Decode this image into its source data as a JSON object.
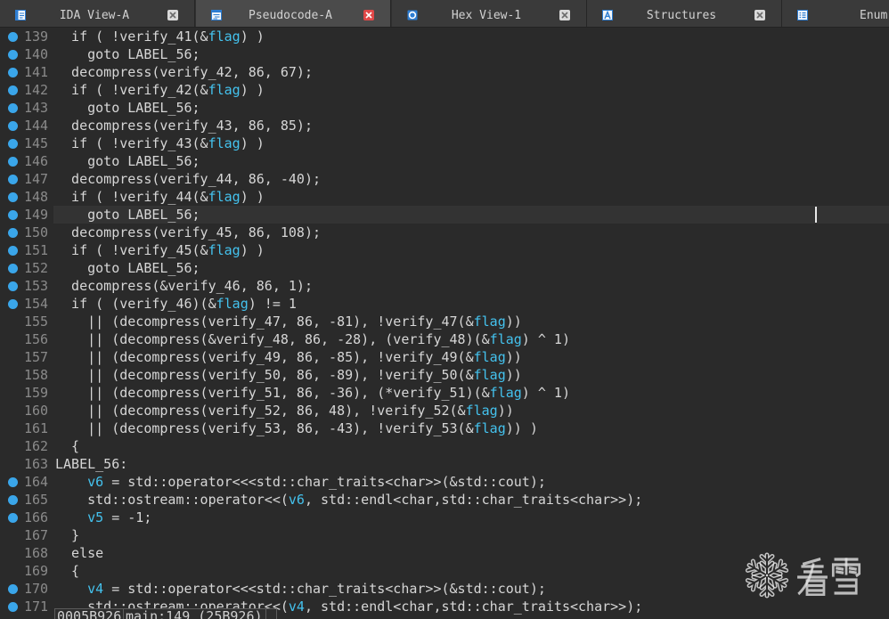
{
  "tabs": [
    {
      "label": "IDA View-A",
      "icon": "ida-view-icon",
      "active": false
    },
    {
      "label": "Pseudocode-A",
      "icon": "pseudocode-icon",
      "active": true
    },
    {
      "label": "Hex View-1",
      "icon": "hex-view-icon",
      "active": false
    },
    {
      "label": "Structures",
      "icon": "structures-icon",
      "active": false
    },
    {
      "label": "Enum",
      "icon": "enums-icon",
      "active": false
    }
  ],
  "colors": {
    "background": "#2a2a2a",
    "tab": "#3a3a3a",
    "active_tab": "#4b4b4b",
    "tab_text": "#d2d2d2",
    "close_active": "#e04848",
    "code_text": "#d6d6d6",
    "variable": "#44c2ee",
    "line_number": "#8a8a8a",
    "address_dot": "#3aa6ea",
    "current_line": "#333333"
  },
  "code": {
    "lines": [
      {
        "n": "139",
        "dot": true,
        "seg": [
          {
            "t": "  if ( !verify_41(&"
          },
          {
            "t": "flag",
            "c": "var"
          },
          {
            "t": ") )"
          }
        ]
      },
      {
        "n": "140",
        "dot": true,
        "seg": [
          {
            "t": "    goto LABEL_56;"
          }
        ]
      },
      {
        "n": "141",
        "dot": true,
        "seg": [
          {
            "t": "  decompress(verify_42, 86, 67);"
          }
        ]
      },
      {
        "n": "142",
        "dot": true,
        "seg": [
          {
            "t": "  if ( !verify_42(&"
          },
          {
            "t": "flag",
            "c": "var"
          },
          {
            "t": ") )"
          }
        ]
      },
      {
        "n": "143",
        "dot": true,
        "seg": [
          {
            "t": "    goto LABEL_56;"
          }
        ]
      },
      {
        "n": "144",
        "dot": true,
        "seg": [
          {
            "t": "  decompress(verify_43, 86, 85);"
          }
        ]
      },
      {
        "n": "145",
        "dot": true,
        "seg": [
          {
            "t": "  if ( !verify_43(&"
          },
          {
            "t": "flag",
            "c": "var"
          },
          {
            "t": ") )"
          }
        ]
      },
      {
        "n": "146",
        "dot": true,
        "seg": [
          {
            "t": "    goto LABEL_56;"
          }
        ]
      },
      {
        "n": "147",
        "dot": true,
        "seg": [
          {
            "t": "  decompress(verify_44, 86, -40);"
          }
        ]
      },
      {
        "n": "148",
        "dot": true,
        "seg": [
          {
            "t": "  if ( !verify_44(&"
          },
          {
            "t": "flag",
            "c": "var"
          },
          {
            "t": ") )"
          }
        ]
      },
      {
        "n": "149",
        "dot": true,
        "current": true,
        "seg": [
          {
            "t": "    goto LABEL_56;"
          }
        ]
      },
      {
        "n": "150",
        "dot": true,
        "seg": [
          {
            "t": "  decompress(verify_45, 86, 108);"
          }
        ]
      },
      {
        "n": "151",
        "dot": true,
        "seg": [
          {
            "t": "  if ( !verify_45(&"
          },
          {
            "t": "flag",
            "c": "var"
          },
          {
            "t": ") )"
          }
        ]
      },
      {
        "n": "152",
        "dot": true,
        "seg": [
          {
            "t": "    goto LABEL_56;"
          }
        ]
      },
      {
        "n": "153",
        "dot": true,
        "seg": [
          {
            "t": "  decompress(&verify_46, 86, 1);"
          }
        ]
      },
      {
        "n": "154",
        "dot": true,
        "seg": [
          {
            "t": "  if ( (verify_46)(&"
          },
          {
            "t": "flag",
            "c": "var"
          },
          {
            "t": ") != 1"
          }
        ]
      },
      {
        "n": "155",
        "dot": false,
        "seg": [
          {
            "t": "    || (decompress(verify_47, 86, -81), !verify_47(&"
          },
          {
            "t": "flag",
            "c": "var"
          },
          {
            "t": "))"
          }
        ]
      },
      {
        "n": "156",
        "dot": false,
        "seg": [
          {
            "t": "    || (decompress(&verify_48, 86, -28), (verify_48)(&"
          },
          {
            "t": "flag",
            "c": "var"
          },
          {
            "t": ") ^ 1)"
          }
        ]
      },
      {
        "n": "157",
        "dot": false,
        "seg": [
          {
            "t": "    || (decompress(verify_49, 86, -85), !verify_49(&"
          },
          {
            "t": "flag",
            "c": "var"
          },
          {
            "t": "))"
          }
        ]
      },
      {
        "n": "158",
        "dot": false,
        "seg": [
          {
            "t": "    || (decompress(verify_50, 86, -89), !verify_50(&"
          },
          {
            "t": "flag",
            "c": "var"
          },
          {
            "t": "))"
          }
        ]
      },
      {
        "n": "159",
        "dot": false,
        "seg": [
          {
            "t": "    || (decompress(verify_51, 86, -36), (*verify_51)(&"
          },
          {
            "t": "flag",
            "c": "var"
          },
          {
            "t": ") ^ 1)"
          }
        ]
      },
      {
        "n": "160",
        "dot": false,
        "seg": [
          {
            "t": "    || (decompress(verify_52, 86, 48), !verify_52(&"
          },
          {
            "t": "flag",
            "c": "var"
          },
          {
            "t": "))"
          }
        ]
      },
      {
        "n": "161",
        "dot": false,
        "seg": [
          {
            "t": "    || (decompress(verify_53, 86, -43), !verify_53(&"
          },
          {
            "t": "flag",
            "c": "var"
          },
          {
            "t": ")) )"
          }
        ]
      },
      {
        "n": "162",
        "dot": false,
        "seg": [
          {
            "t": "  {"
          }
        ]
      },
      {
        "n": "163",
        "dot": false,
        "seg": [
          {
            "t": "LABEL_56:"
          }
        ]
      },
      {
        "n": "164",
        "dot": true,
        "seg": [
          {
            "t": "    "
          },
          {
            "t": "v6",
            "c": "var"
          },
          {
            "t": " = std::operator<<<std::char_traits<char>>(&std::cout);"
          }
        ]
      },
      {
        "n": "165",
        "dot": true,
        "seg": [
          {
            "t": "    std::ostream::operator<<("
          },
          {
            "t": "v6",
            "c": "var"
          },
          {
            "t": ", std::endl<char,std::char_traits<char>>);"
          }
        ]
      },
      {
        "n": "166",
        "dot": true,
        "seg": [
          {
            "t": "    "
          },
          {
            "t": "v5",
            "c": "var"
          },
          {
            "t": " = -1;"
          }
        ]
      },
      {
        "n": "167",
        "dot": false,
        "seg": [
          {
            "t": "  }"
          }
        ]
      },
      {
        "n": "168",
        "dot": false,
        "seg": [
          {
            "t": "  else"
          }
        ]
      },
      {
        "n": "169",
        "dot": false,
        "seg": [
          {
            "t": "  {"
          }
        ]
      },
      {
        "n": "170",
        "dot": true,
        "seg": [
          {
            "t": "    "
          },
          {
            "t": "v4",
            "c": "var"
          },
          {
            "t": " = std::operator<<<std::char_traits<char>>(&std::cout);"
          }
        ]
      },
      {
        "n": "171",
        "dot": true,
        "seg": [
          {
            "t": "    std::ostream::operator<<("
          },
          {
            "t": "v4",
            "c": "var"
          },
          {
            "t": ", std::endl<char,std::char_traits<char>>);"
          }
        ]
      }
    ]
  },
  "status": {
    "address": "0005B926",
    "location": "main:149 (25B926)"
  },
  "watermark": {
    "text": "看雪",
    "icon": "snowflake-icon"
  }
}
